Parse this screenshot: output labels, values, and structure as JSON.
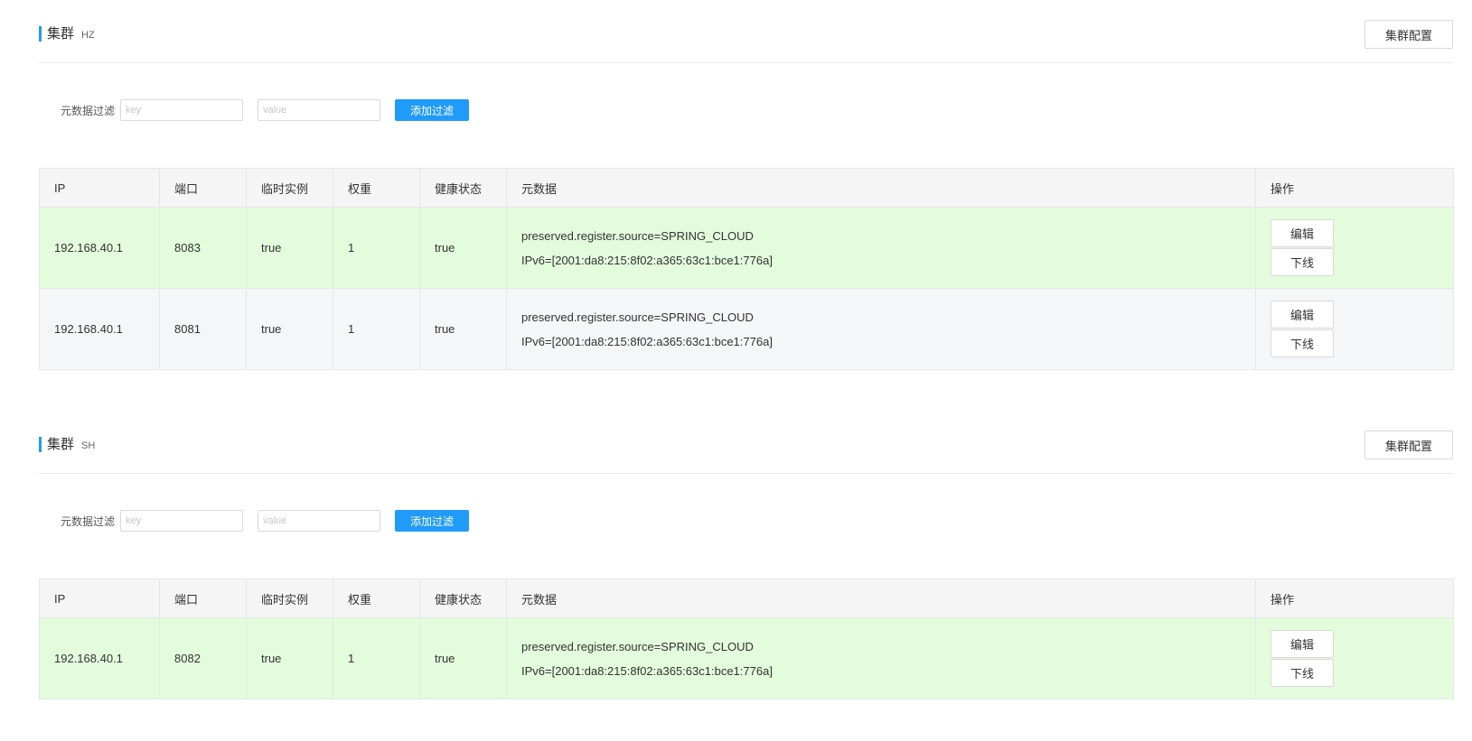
{
  "table_headers": {
    "ip": "IP",
    "port": "端口",
    "ephemeral": "临时实例",
    "weight": "权重",
    "healthy": "健康状态",
    "metadata": "元数据",
    "ops": "操作"
  },
  "clusters": [
    {
      "title": "集群",
      "name": "HZ",
      "config_button": "集群配置",
      "filter": {
        "label": "元数据过滤",
        "key_placeholder": "key",
        "value_placeholder": "value",
        "add_button": "添加过滤"
      },
      "rows": [
        {
          "ip": "192.168.40.1",
          "port": "8083",
          "ephemeral": "true",
          "weight": "1",
          "healthy": "true",
          "metadata": [
            "preserved.register.source=SPRING_CLOUD",
            "IPv6=[2001:da8:215:8f02:a365:63c1:bce1:776a]"
          ],
          "edit": "编辑",
          "offline": "下线",
          "row_color": "#e3fcdc"
        },
        {
          "ip": "192.168.40.1",
          "port": "8081",
          "ephemeral": "true",
          "weight": "1",
          "healthy": "true",
          "metadata": [
            "preserved.register.source=SPRING_CLOUD",
            "IPv6=[2001:da8:215:8f02:a365:63c1:bce1:776a]"
          ],
          "edit": "编辑",
          "offline": "下线",
          "row_color": "#f5f6f8"
        }
      ]
    },
    {
      "title": "集群",
      "name": "SH",
      "config_button": "集群配置",
      "filter": {
        "label": "元数据过滤",
        "key_placeholder": "key",
        "value_placeholder": "value",
        "add_button": "添加过滤"
      },
      "rows": [
        {
          "ip": "192.168.40.1",
          "port": "8082",
          "ephemeral": "true",
          "weight": "1",
          "healthy": "true",
          "metadata": [
            "preserved.register.source=SPRING_CLOUD",
            "IPv6=[2001:da8:215:8f02:a365:63c1:bce1:776a]"
          ],
          "edit": "编辑",
          "offline": "下线",
          "row_color": "#e3fcdc"
        }
      ]
    }
  ],
  "colors": {
    "accent": "#209bfa",
    "header_bg": "#f5f5f5",
    "row_green": "#e3fcdc",
    "row_gray": "#f5f6f8"
  }
}
